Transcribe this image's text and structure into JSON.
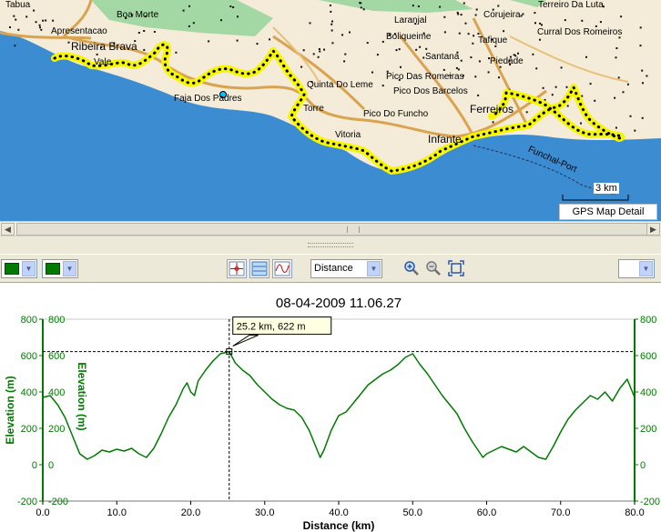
{
  "map": {
    "places": [
      {
        "name": "Tabua",
        "size": "small"
      },
      {
        "name": "Boa Morte",
        "size": "small"
      },
      {
        "name": "Apresentacao",
        "size": "small"
      },
      {
        "name": "Ribeira Brava",
        "size": "big"
      },
      {
        "name": "Vale",
        "size": "small"
      },
      {
        "name": "Faja Dos Padres",
        "size": "small"
      },
      {
        "name": "Laranjal",
        "size": "small"
      },
      {
        "name": "Boliqueime",
        "size": "small"
      },
      {
        "name": "Santana",
        "size": "small"
      },
      {
        "name": "Corujeira",
        "size": "small"
      },
      {
        "name": "Terreiro Da Luta",
        "size": "small"
      },
      {
        "name": "Tafique",
        "size": "small"
      },
      {
        "name": "Curral Dos Romeiros",
        "size": "small"
      },
      {
        "name": "Piedade",
        "size": "small"
      },
      {
        "name": "Quinta Do Leme",
        "size": "small"
      },
      {
        "name": "Pico Das Romeiras",
        "size": "small"
      },
      {
        "name": "Pico Dos Barcelos",
        "size": "small"
      },
      {
        "name": "Torre",
        "size": "small"
      },
      {
        "name": "Pico Do Funcho",
        "size": "small"
      },
      {
        "name": "Ferreiros",
        "size": "big"
      },
      {
        "name": "Vitoria",
        "size": "small"
      },
      {
        "name": "Infante",
        "size": "big"
      },
      {
        "name": "Funchal-Port",
        "size": "small"
      }
    ],
    "scale_label": "3 km",
    "detail_label": "GPS Map Detail",
    "colors": {
      "sea": "#3c8cd2",
      "land": "#f4ecd9",
      "green_area": "#a3d7a3",
      "road": "#d9a34f",
      "track_halo": "#f6f600",
      "track_dot": "#000000"
    }
  },
  "toolbar": {
    "line_color_1": "#007a00",
    "line_color_2": "#007a00",
    "x_axis_option": "Distance",
    "icons": [
      "crosshair-icon",
      "horizontal-lines-icon",
      "wave-graph-icon",
      "zoom-in-icon",
      "zoom-out-icon",
      "zoom-fit-icon"
    ]
  },
  "chart_data": {
    "type": "line",
    "title": "08-04-2009 11.06.27",
    "xlabel": "Distance (km)",
    "ylabel": "Elevation (m)",
    "ylabel_right": "Elevation (m)",
    "xlim": [
      0,
      80
    ],
    "ylim": [
      -200,
      800
    ],
    "x_ticks": [
      "0.0",
      "10.0",
      "20.0",
      "30.0",
      "40.0",
      "50.0",
      "60.0",
      "70.0",
      "80.0"
    ],
    "y_ticks": [
      "800",
      "600",
      "400",
      "200",
      "0",
      "-200"
    ],
    "grid": false,
    "color": "#007a00",
    "cursor": {
      "x": 25.2,
      "y": 622,
      "label": "25.2 km, 622 m"
    },
    "x": [
      0,
      1,
      2,
      3,
      4,
      5,
      6,
      7,
      8,
      9,
      10,
      11,
      12,
      13,
      14,
      15,
      16,
      17,
      18,
      19,
      19.5,
      20,
      20.5,
      21,
      22,
      23,
      24,
      25.2,
      26,
      27,
      28,
      29,
      30,
      31,
      32,
      33,
      34,
      35,
      36,
      37,
      37.5,
      38,
      39,
      40,
      41,
      42,
      43,
      44,
      45,
      46,
      47,
      48,
      49,
      50,
      51,
      52,
      53,
      54,
      55,
      56,
      57,
      58,
      59,
      59.5,
      60,
      61,
      62,
      63,
      64,
      65,
      66,
      67,
      68,
      69,
      70,
      71,
      72,
      73,
      74,
      75,
      76,
      77,
      78,
      79,
      80
    ],
    "y": [
      370,
      380,
      330,
      260,
      160,
      60,
      30,
      50,
      80,
      70,
      85,
      75,
      90,
      60,
      40,
      90,
      170,
      260,
      330,
      420,
      450,
      400,
      380,
      460,
      520,
      570,
      610,
      622,
      560,
      520,
      490,
      440,
      400,
      360,
      330,
      310,
      300,
      260,
      190,
      90,
      40,
      80,
      190,
      270,
      290,
      340,
      390,
      440,
      470,
      500,
      520,
      550,
      590,
      610,
      550,
      500,
      440,
      380,
      330,
      280,
      200,
      130,
      70,
      40,
      60,
      80,
      100,
      85,
      70,
      100,
      70,
      40,
      30,
      100,
      180,
      250,
      300,
      340,
      380,
      360,
      400,
      350,
      420,
      470,
      370
    ]
  }
}
